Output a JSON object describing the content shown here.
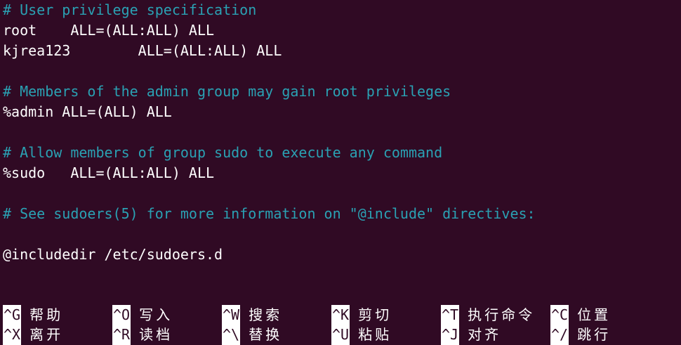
{
  "editor": {
    "lines": [
      {
        "type": "comment",
        "text": "# User privilege specification"
      },
      {
        "type": "code",
        "text": "root    ALL=(ALL:ALL) ALL"
      },
      {
        "type": "code",
        "text": "kjrea123        ALL=(ALL:ALL) ALL"
      },
      {
        "type": "blank",
        "text": ""
      },
      {
        "type": "comment",
        "text": "# Members of the admin group may gain root privileges"
      },
      {
        "type": "code",
        "text": "%admin ALL=(ALL) ALL"
      },
      {
        "type": "blank",
        "text": ""
      },
      {
        "type": "comment",
        "text": "# Allow members of group sudo to execute any command"
      },
      {
        "type": "code",
        "text": "%sudo   ALL=(ALL:ALL) ALL"
      },
      {
        "type": "blank",
        "text": ""
      },
      {
        "type": "comment",
        "text": "# See sudoers(5) for more information on \"@include\" directives:"
      },
      {
        "type": "blank",
        "text": ""
      },
      {
        "type": "code",
        "text": "@includedir /etc/sudoers.d"
      }
    ]
  },
  "shortcuts": {
    "row1": [
      {
        "key": "^G",
        "label": "帮助"
      },
      {
        "key": "^O",
        "label": "写入"
      },
      {
        "key": "^W",
        "label": "搜索"
      },
      {
        "key": "^K",
        "label": "剪切"
      },
      {
        "key": "^T",
        "label": "执行命令"
      },
      {
        "key": "^C",
        "label": "位置"
      }
    ],
    "row2": [
      {
        "key": "^X",
        "label": "离开"
      },
      {
        "key": "^R",
        "label": "读档"
      },
      {
        "key": "^\\",
        "label": "替换"
      },
      {
        "key": "^U",
        "label": "粘贴"
      },
      {
        "key": "^J",
        "label": "对齐"
      },
      {
        "key": "^/",
        "label": "跳行"
      }
    ]
  },
  "colors": {
    "background": "#300a24",
    "comment": "#2aa1b3",
    "text": "#ffffff"
  }
}
